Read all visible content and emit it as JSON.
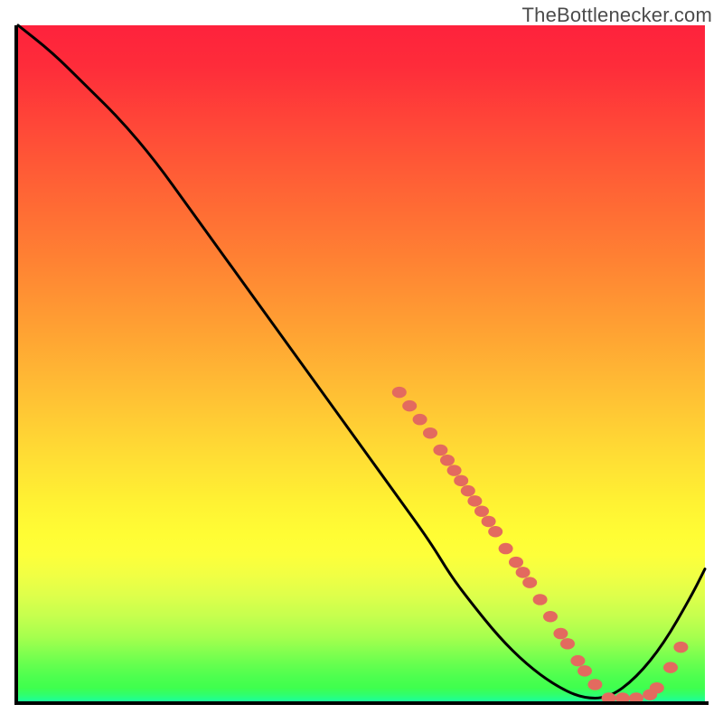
{
  "watermark": "TheBottlenecker.com",
  "chart_data": {
    "type": "line",
    "title": "",
    "xlabel": "",
    "ylabel": "",
    "xlim": [
      0,
      100
    ],
    "ylim": [
      0,
      100
    ],
    "background": "gradient-rainbow-vertical",
    "series": [
      {
        "name": "bottleneck-curve",
        "color": "#000000",
        "x": [
          0,
          5,
          10,
          15,
          20,
          25,
          30,
          35,
          40,
          45,
          50,
          55,
          60,
          63,
          66,
          70,
          74,
          78,
          82,
          86,
          90,
          94,
          98,
          100
        ],
        "values": [
          100,
          96,
          91,
          86,
          80,
          73,
          66,
          59,
          52,
          45,
          38,
          31,
          24,
          19,
          15,
          10,
          6,
          3,
          1,
          1,
          4,
          9,
          16,
          20
        ]
      }
    ],
    "markers": {
      "name": "data-points",
      "color": "#e36a5f",
      "radius": 8,
      "points": [
        {
          "x": 55.5,
          "y": 46.0
        },
        {
          "x": 57.0,
          "y": 44.0
        },
        {
          "x": 58.5,
          "y": 42.0
        },
        {
          "x": 60.0,
          "y": 40.0
        },
        {
          "x": 61.5,
          "y": 37.5
        },
        {
          "x": 62.5,
          "y": 36.0
        },
        {
          "x": 63.5,
          "y": 34.5
        },
        {
          "x": 64.5,
          "y": 33.0
        },
        {
          "x": 65.5,
          "y": 31.5
        },
        {
          "x": 66.5,
          "y": 30.0
        },
        {
          "x": 67.5,
          "y": 28.5
        },
        {
          "x": 68.5,
          "y": 27.0
        },
        {
          "x": 69.5,
          "y": 25.5
        },
        {
          "x": 71.0,
          "y": 23.0
        },
        {
          "x": 72.5,
          "y": 21.0
        },
        {
          "x": 73.5,
          "y": 19.5
        },
        {
          "x": 74.5,
          "y": 18.0
        },
        {
          "x": 76.0,
          "y": 15.5
        },
        {
          "x": 77.5,
          "y": 13.0
        },
        {
          "x": 79.0,
          "y": 10.5
        },
        {
          "x": 80.0,
          "y": 9.0
        },
        {
          "x": 81.5,
          "y": 6.5
        },
        {
          "x": 82.5,
          "y": 5.0
        },
        {
          "x": 84.0,
          "y": 3.0
        },
        {
          "x": 86.0,
          "y": 1.0
        },
        {
          "x": 88.0,
          "y": 1.0
        },
        {
          "x": 90.0,
          "y": 1.0
        },
        {
          "x": 92.0,
          "y": 1.5
        },
        {
          "x": 93.0,
          "y": 2.5
        },
        {
          "x": 95.0,
          "y": 5.5
        },
        {
          "x": 96.5,
          "y": 8.5
        }
      ]
    }
  }
}
